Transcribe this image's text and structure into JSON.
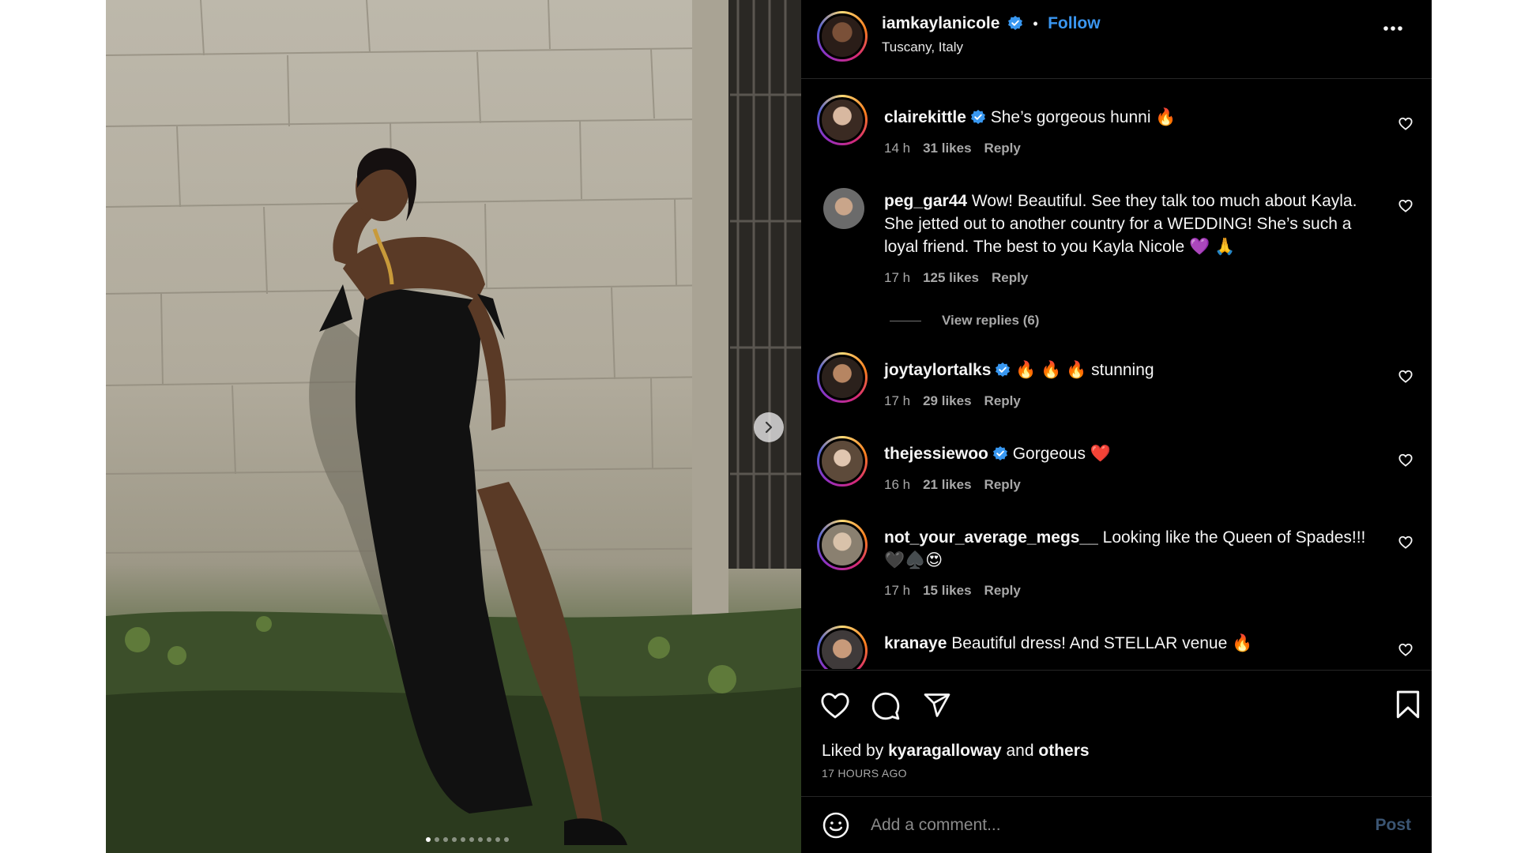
{
  "post": {
    "author": "iamkaylanicole",
    "separator": "•",
    "follow_label": "Follow",
    "location": "Tuscany, Italy",
    "more_icon": "more-horizontal-icon"
  },
  "carousel": {
    "slide_count": 10,
    "active_slide": 1,
    "next_icon": "chevron-right-icon"
  },
  "comments": [
    {
      "user": "clairekittle",
      "verified": true,
      "text": "She’s gorgeous hunni 🔥",
      "time": "14 h",
      "likes": "31 likes",
      "reply": "Reply"
    },
    {
      "user": "peg_gar44",
      "verified": false,
      "text": "Wow! Beautiful. See they talk too much about Kayla. She jetted out to another country for a WEDDING! She’s such a loyal friend. The best to you Kayla Nicole 💜 🙏",
      "time": "17 h",
      "likes": "125 likes",
      "reply": "Reply",
      "view_replies": "View replies (6)"
    },
    {
      "user": "joytaylortalks",
      "verified": true,
      "text": "🔥 🔥 🔥 stunning",
      "time": "17 h",
      "likes": "29 likes",
      "reply": "Reply"
    },
    {
      "user": "thejessiewoo",
      "verified": true,
      "text": "Gorgeous ❤️",
      "time": "16 h",
      "likes": "21 likes",
      "reply": "Reply"
    },
    {
      "user": "not_your_average_megs__",
      "verified": false,
      "text": "Looking like the Queen of Spades!!! 🖤♠️😍",
      "time": "17 h",
      "likes": "15 likes",
      "reply": "Reply"
    },
    {
      "user": "kranaye",
      "verified": false,
      "text": "Beautiful dress! And STELLAR venue 🔥"
    }
  ],
  "actions": {
    "like_icon": "heart-icon",
    "comment_icon": "comment-icon",
    "share_icon": "send-icon",
    "save_icon": "bookmark-icon",
    "liked_prefix": "Liked by",
    "liked_user": "kyaragalloway",
    "liked_and": "and",
    "liked_others": "others",
    "time_ago": "17 HOURS AGO"
  },
  "composer": {
    "placeholder": "Add a comment...",
    "post_label": "Post",
    "emoji_icon": "emoji-icon"
  },
  "colors": {
    "panel_bg": "#000000",
    "link_blue": "#3a96f0",
    "muted_text": "#a8a8a8",
    "post_disabled": "#3b5573",
    "verified_blue": "#3897f0"
  }
}
